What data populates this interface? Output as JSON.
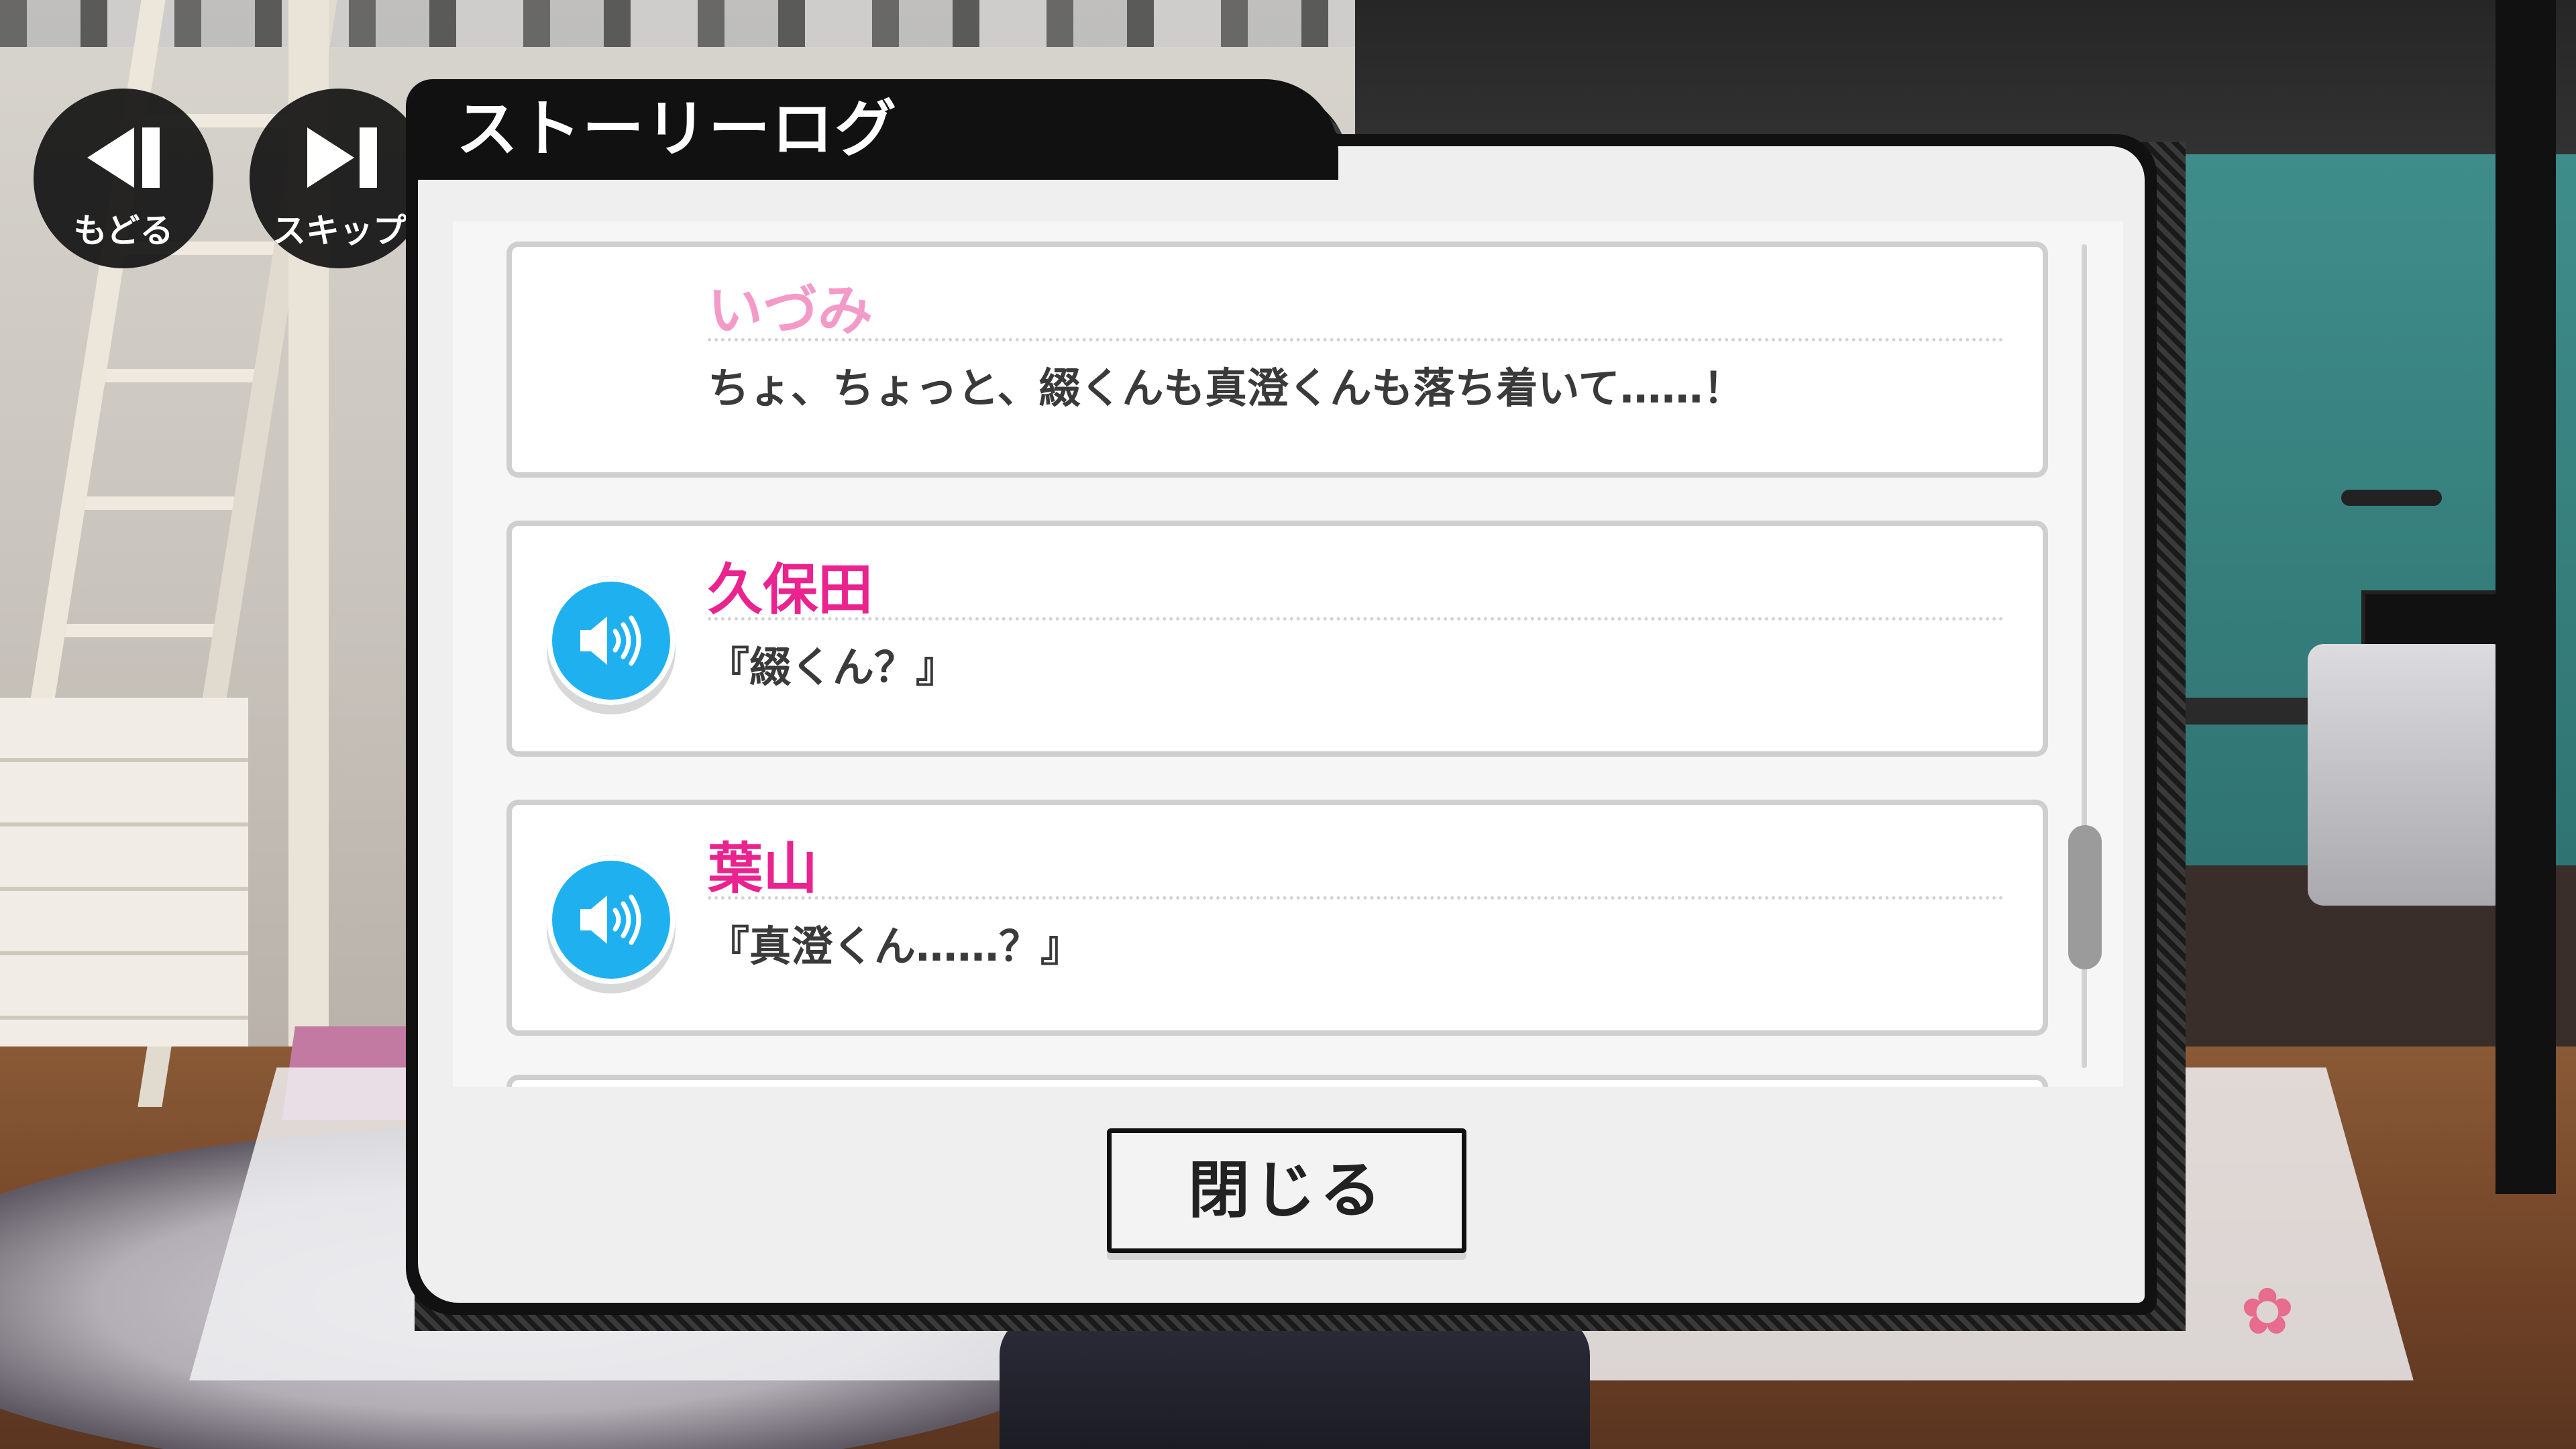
{
  "controls": {
    "back_label": "もどる",
    "skip_label": "スキップ"
  },
  "story_log": {
    "title": "ストーリーログ",
    "entries": [
      {
        "name": "いづみ",
        "text": "ちょ、ちょっと、綴くんも真澄くんも落ち着いて……！",
        "has_voice": false
      },
      {
        "name": "久保田",
        "text": "『綴くん？』",
        "has_voice": true
      },
      {
        "name": "葉山",
        "text": "『真澄くん……？』",
        "has_voice": true
      }
    ],
    "close_label": "閉じる"
  },
  "icons": {
    "back": "rewind-icon",
    "skip": "skip-forward-icon",
    "voice": "speaker-icon",
    "flower": "flower-icon"
  },
  "colors": {
    "voice_button": "#1fb1ef",
    "name_inactive": "#f39ac8",
    "name_active": "#ea238f",
    "panel_frame": "#111111"
  }
}
